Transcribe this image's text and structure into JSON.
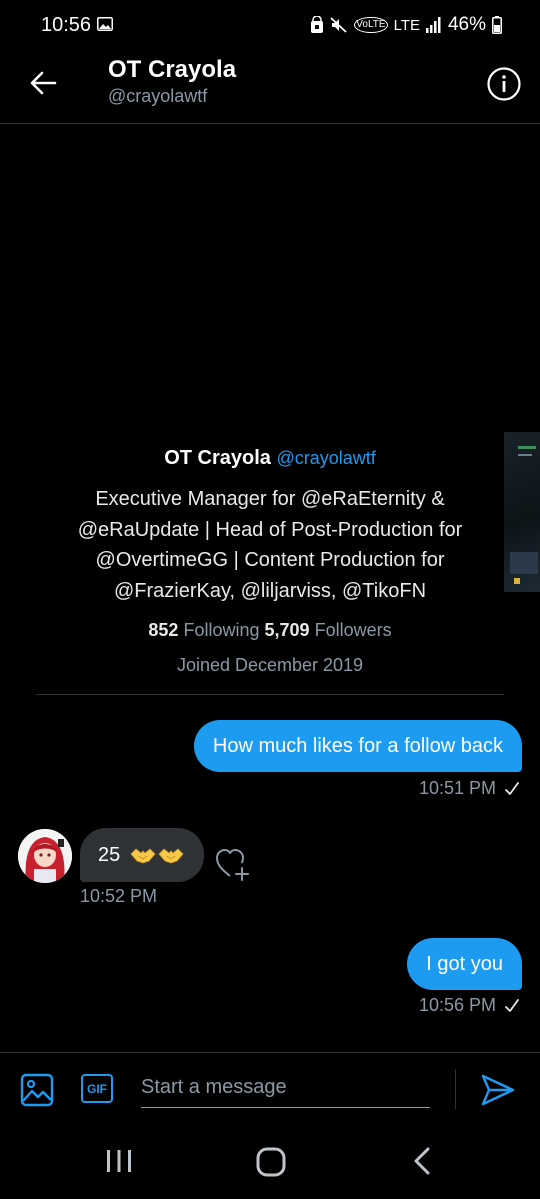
{
  "status_bar": {
    "time": "10:56",
    "network": "LTE",
    "volte": "VoLTE",
    "battery": "46%"
  },
  "header": {
    "title": "OT Crayola",
    "handle": "@crayolawtf"
  },
  "profile": {
    "name": "OT Crayola",
    "handle": "@crayolawtf",
    "bio": "Executive Manager for @eRaEternity & @eRaUpdate | Head of Post-Production for @OvertimeGG | Content Production for @FrazierKay, @liljarviss, @TikoFN",
    "following_count": "852",
    "following_label": "Following",
    "followers_count": "5,709",
    "followers_label": "Followers",
    "joined": "Joined December 2019"
  },
  "messages": [
    {
      "direction": "outgoing",
      "text": "How much likes for a follow back",
      "time": "10:51 PM"
    },
    {
      "direction": "incoming",
      "text": "25",
      "time": "10:52 PM"
    },
    {
      "direction": "outgoing",
      "text": "I got you",
      "time": "10:56 PM"
    }
  ],
  "composer": {
    "placeholder": "Start a message",
    "gif_label": "GIF"
  },
  "colors": {
    "accent": "#1d9bf0",
    "background": "#000000",
    "incoming_bubble": "#2f3336",
    "secondary_text": "#8b98a5"
  },
  "icons": {
    "back": "arrow-left-icon",
    "info": "info-circle-icon",
    "check": "check-icon",
    "react": "heart-plus-icon",
    "media": "image-icon",
    "gif": "gif-icon",
    "send": "send-icon"
  }
}
